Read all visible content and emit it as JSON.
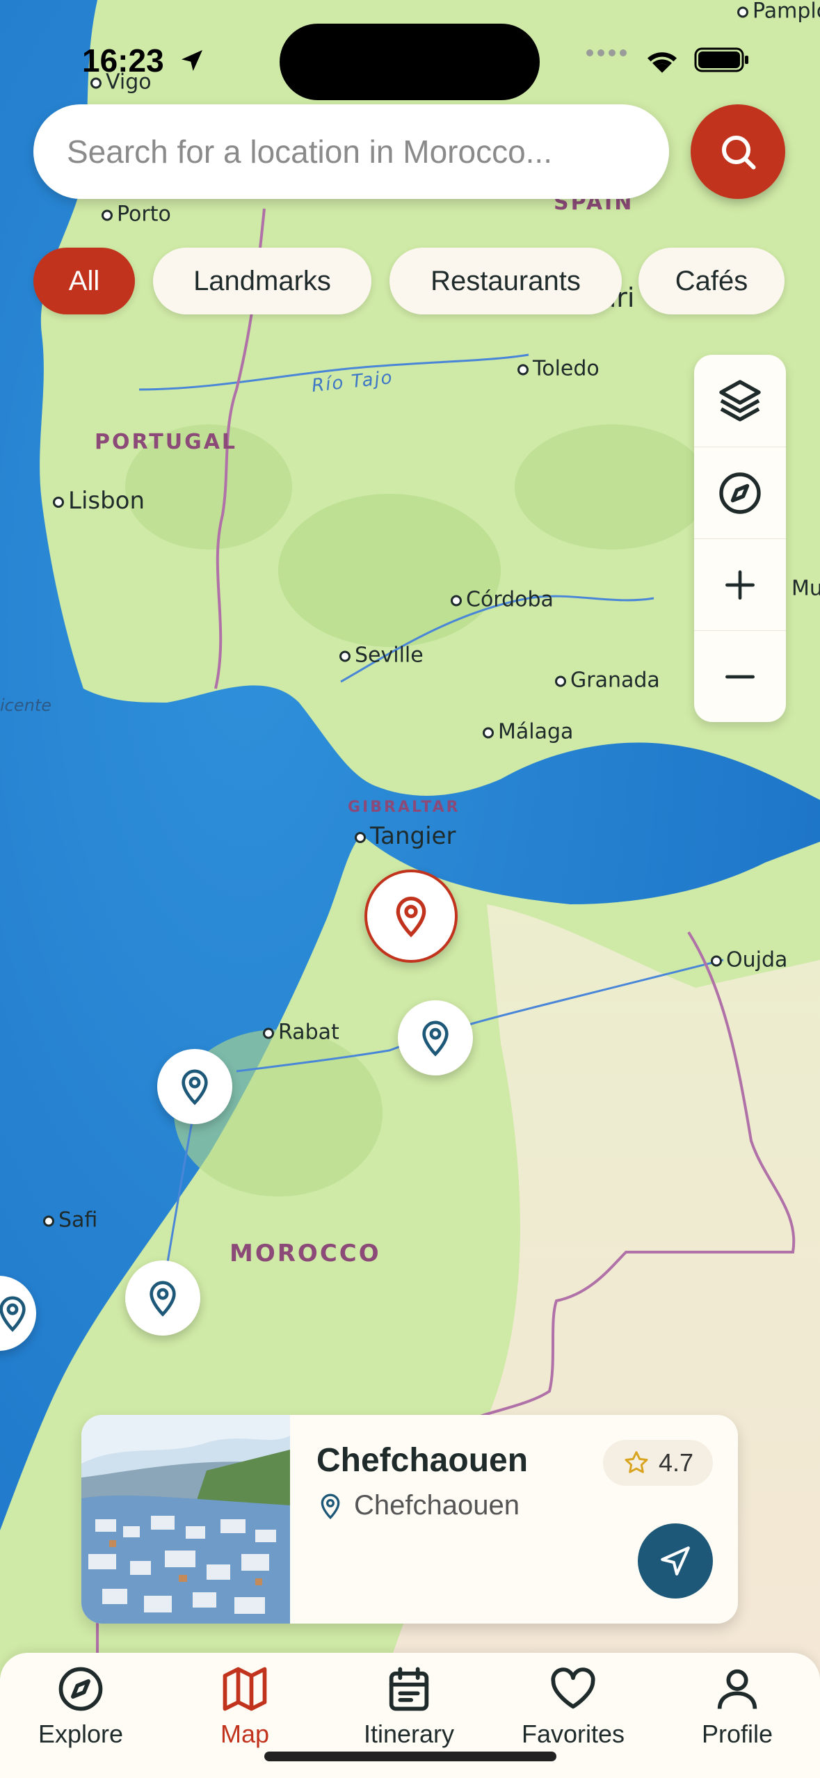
{
  "status": {
    "time": "16:23"
  },
  "search": {
    "placeholder": "Search for a location in Morocco..."
  },
  "chips": [
    {
      "label": "All",
      "active": true
    },
    {
      "label": "Landmarks",
      "active": false
    },
    {
      "label": "Restaurants",
      "active": false
    },
    {
      "label": "Cafés",
      "active": false
    }
  ],
  "map": {
    "cities": [
      "Vigo",
      "Porto",
      "Toledo",
      "Lisbon",
      "Córdoba",
      "Seville",
      "Granada",
      "Málaga",
      "Tangier",
      "Oujda",
      "Rabat",
      "Safi"
    ],
    "countries": [
      "PORTUGAL",
      "SPAIN",
      "MOROCCO",
      "GIBRALTAR"
    ],
    "river": "Río Tajo",
    "partial_labels": {
      "pamplona": "Pamplo",
      "madrid": "Madri",
      "murcia": "Mu",
      "cabo": "icente"
    }
  },
  "map_controls": [
    "layers-icon",
    "compass-icon",
    "zoom-in-icon",
    "zoom-out-icon"
  ],
  "selected_place": {
    "title": "Chefchaouen",
    "location": "Chefchaouen",
    "rating": "4.7"
  },
  "tabs": [
    {
      "label": "Explore",
      "icon": "compass-icon"
    },
    {
      "label": "Map",
      "icon": "map-icon",
      "active": true
    },
    {
      "label": "Itinerary",
      "icon": "calendar-icon"
    },
    {
      "label": "Favorites",
      "icon": "heart-icon"
    },
    {
      "label": "Profile",
      "icon": "user-icon"
    }
  ],
  "colors": {
    "accent": "#c1331c",
    "teal": "#1d5878",
    "land": "#cfe9b0",
    "sea": "#2f8fd6",
    "desert": "#f7ead8"
  }
}
